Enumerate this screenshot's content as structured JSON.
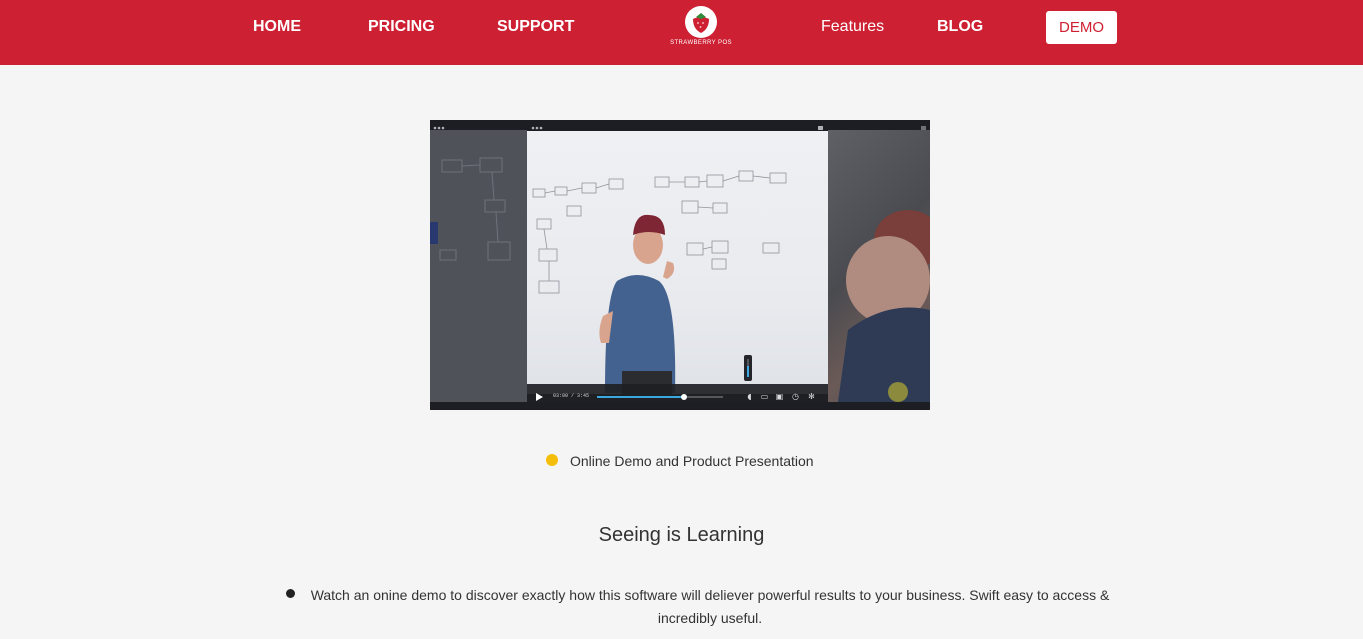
{
  "nav": {
    "left_links": [
      "HOME",
      "PRICING",
      "SUPPORT"
    ],
    "right_links": [
      "Features",
      "BLOG"
    ],
    "logo_text": "STRAWBERRY POS",
    "demo_label": "DEMO"
  },
  "colors": {
    "brand_red": "#ce2033",
    "accent_yellow": "#f5be0b",
    "video_progress": "#3aa8e0"
  },
  "video": {
    "time": "03:00 / 3:45",
    "progress": 0.69,
    "volume": 0.6
  },
  "caption": "Online Demo and Product Presentation",
  "section": {
    "title": "Seeing is Learning",
    "bullet_text": "Watch an onine demo to discover exactly how this software will deliever powerful results to your business. Swift easy to access & incredibly useful."
  }
}
